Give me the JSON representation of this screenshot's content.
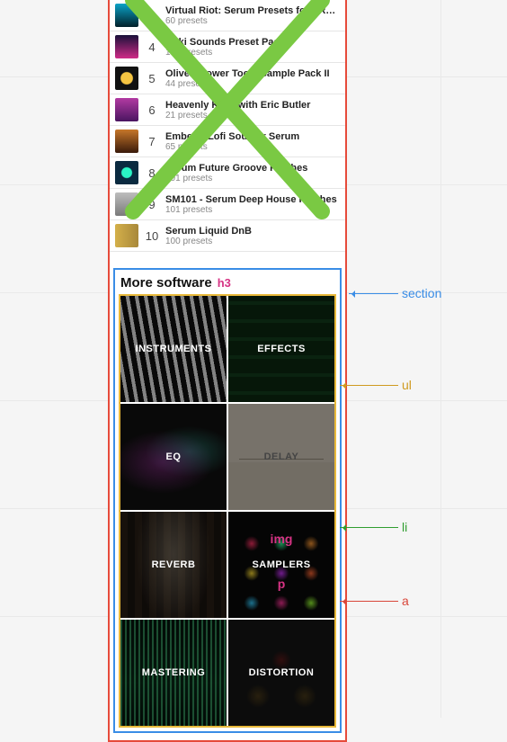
{
  "preset_list": {
    "rows": [
      {
        "rank": "3",
        "title": "Virtual Riot: Serum Presets for PRE…",
        "sub": "60 presets"
      },
      {
        "rank": "4",
        "title": "Aoki Sounds Preset Pack",
        "sub": "180 presets"
      },
      {
        "rank": "5",
        "title": "Oliver: Power Tools Sample Pack II",
        "sub": "44 presets"
      },
      {
        "rank": "6",
        "title": "Heavenly Keys with Eric Butler",
        "sub": "21 presets"
      },
      {
        "rank": "7",
        "title": "Embers: Lofi Soul for Serum",
        "sub": "65 presets"
      },
      {
        "rank": "8",
        "title": "Serum Future Groove Patches",
        "sub": "101 presets"
      },
      {
        "rank": "9",
        "title": "SM101 - Serum Deep House Patches",
        "sub": "101 presets"
      },
      {
        "rank": "10",
        "title": "Serum Liquid DnB",
        "sub": "100 presets"
      }
    ]
  },
  "more_software": {
    "title": "More software",
    "h3_tag": "h3",
    "categories": [
      {
        "label": "INSTRUMENTS"
      },
      {
        "label": "EFFECTS"
      },
      {
        "label": "EQ"
      },
      {
        "label": "DELAY"
      },
      {
        "label": "REVERB"
      },
      {
        "label": "SAMPLERS"
      },
      {
        "label": "MASTERING"
      },
      {
        "label": "DISTORTION"
      }
    ]
  },
  "annotations": {
    "section": "section",
    "ul": "ul",
    "li": "li",
    "a": "a",
    "img": "img",
    "p": "p"
  }
}
